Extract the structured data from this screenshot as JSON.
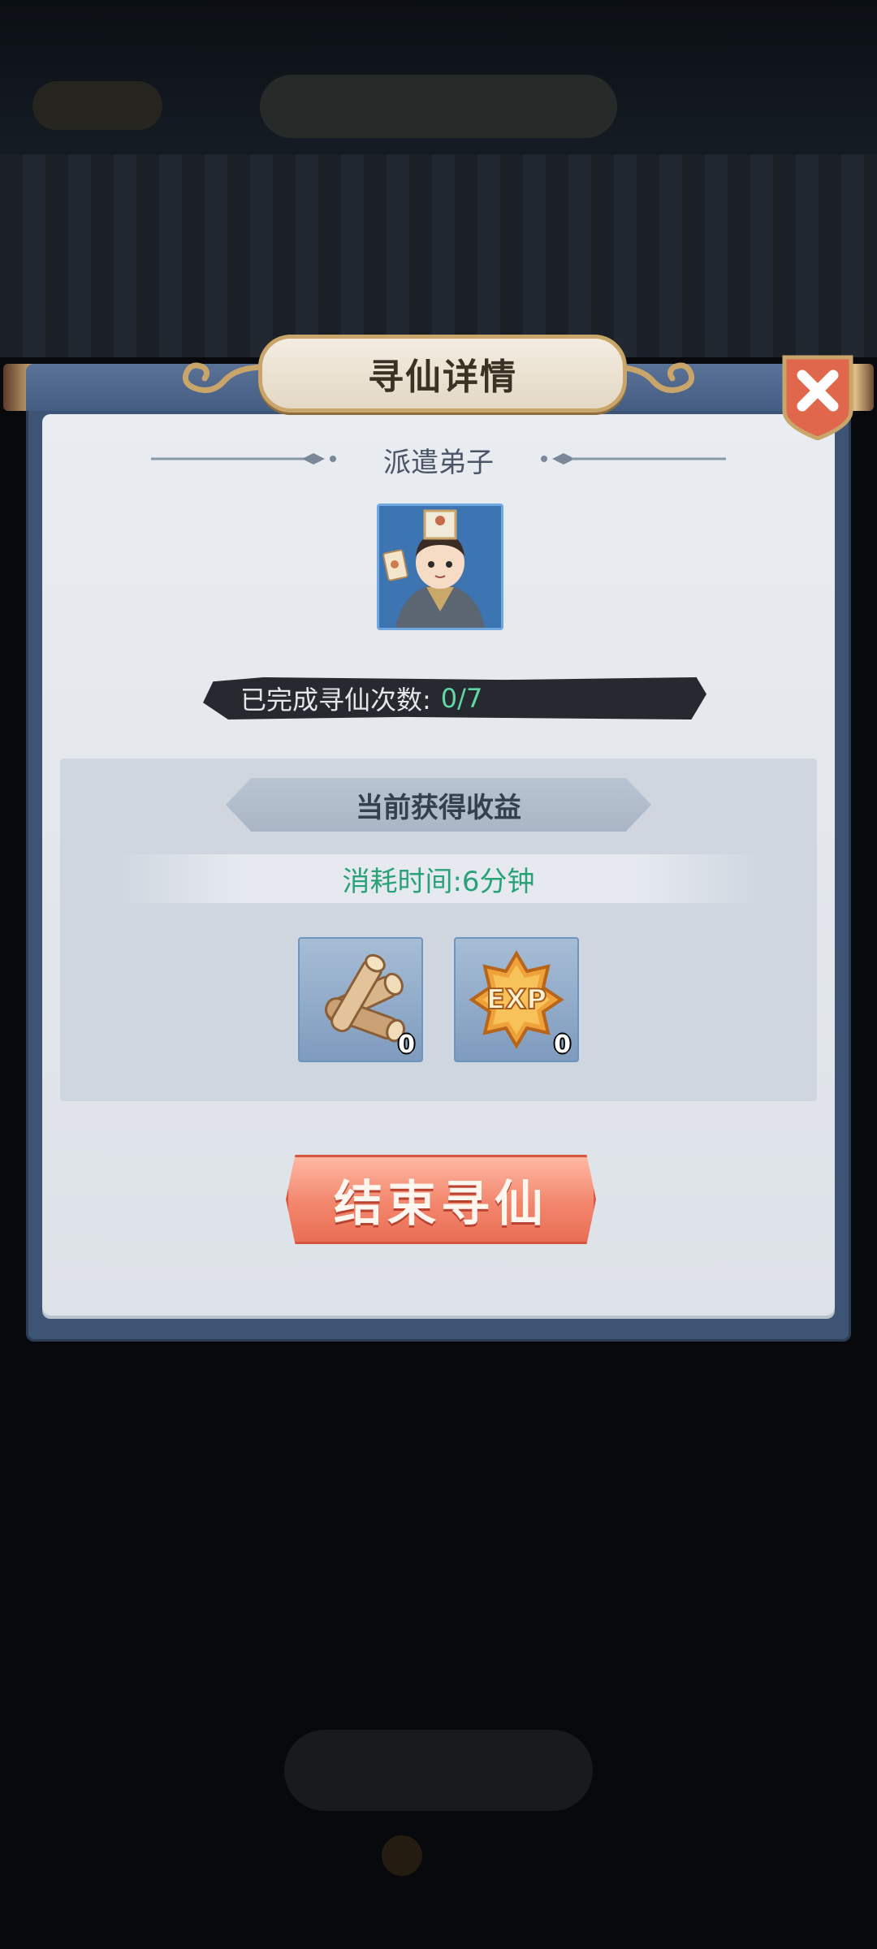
{
  "dialog": {
    "title": "寻仙详情",
    "dispatch_label": "派遣弟子",
    "completed_label": "已完成寻仙次数:",
    "completed_value": "0/7",
    "rewards_header": "当前获得收益",
    "time_text": "消耗时间:6分钟",
    "rewards": [
      {
        "icon": "wood-logs-icon",
        "qty": "0"
      },
      {
        "icon": "exp-badge-icon",
        "qty": "0"
      }
    ],
    "end_button": "结束寻仙"
  },
  "colors": {
    "dialog_frame": "#3e5474",
    "panel_bg": "#e9ecf0",
    "accent_green": "#5fd8a4",
    "time_green": "#2aa278",
    "button_red": "#f2866c"
  }
}
